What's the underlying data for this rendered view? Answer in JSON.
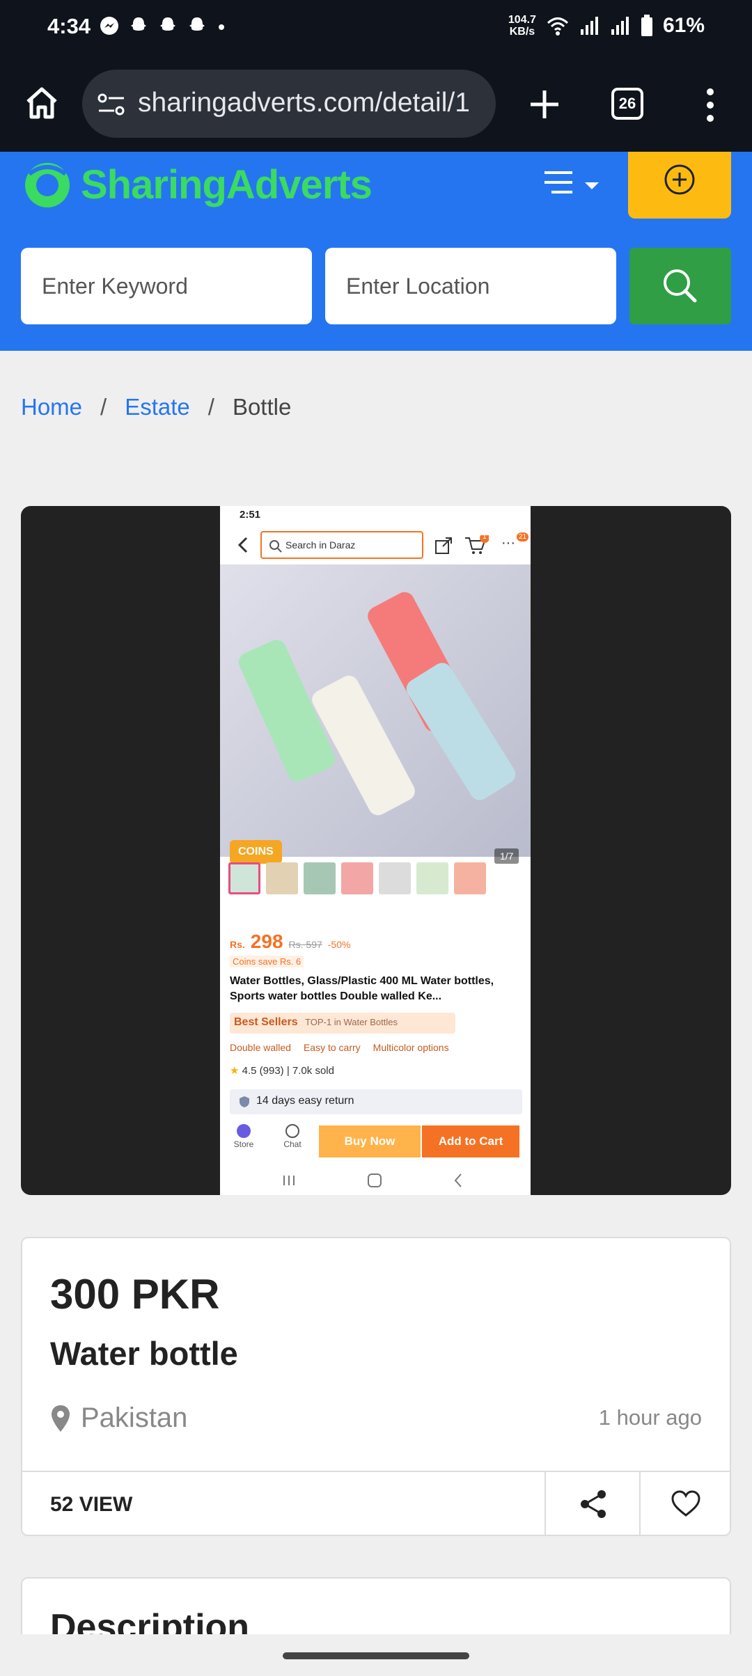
{
  "status_bar": {
    "time": "4:34",
    "speed_value": "104.7",
    "speed_unit": "KB/s",
    "battery": "61%"
  },
  "browser": {
    "url": "sharingadverts.com/detail/1",
    "tab_count": "26"
  },
  "site": {
    "logo_text": "SharingAdverts",
    "keyword_placeholder": "Enter Keyword",
    "location_placeholder": "Enter Location"
  },
  "breadcrumb": {
    "home": "Home",
    "category": "Estate",
    "current": "Bottle"
  },
  "listing_image": {
    "status_time": "2:51",
    "search_text": "Search in Daraz",
    "cart_badge": "1",
    "more_badge": "21",
    "coins_badge": "COINS",
    "page_indicator": "1/7",
    "price_currency": "Rs.",
    "price": "298",
    "old_price": "Rs. 597",
    "discount": "-50%",
    "coins_save": "Coins save Rs. 6",
    "title": "Water Bottles, Glass/Plastic 400 ML Water bottles, Sports water bottles Double walled Ke...",
    "best_sellers": "Best Sellers",
    "best_sellers_sub": "TOP-1 in Water Bottles",
    "tags": [
      "Double walled",
      "Easy to carry",
      "Multicolor options"
    ],
    "rating": "4.5 (993)",
    "sold": "7.0k sold",
    "return_text": "14 days easy return",
    "store_label": "Store",
    "chat_label": "Chat",
    "buy_now": "Buy Now",
    "add_to_cart": "Add to Cart"
  },
  "details": {
    "price": "300 PKR",
    "title": "Water bottle",
    "location": "Pakistan",
    "posted": "1 hour ago",
    "views": "52 VIEW"
  },
  "description": {
    "heading": "Description"
  },
  "colors": {
    "header_blue": "#2575f1",
    "logo_green": "#3adb60",
    "post_yellow": "#fdbb12",
    "search_green": "#2f9e44",
    "daraz_orange": "#f57224"
  }
}
